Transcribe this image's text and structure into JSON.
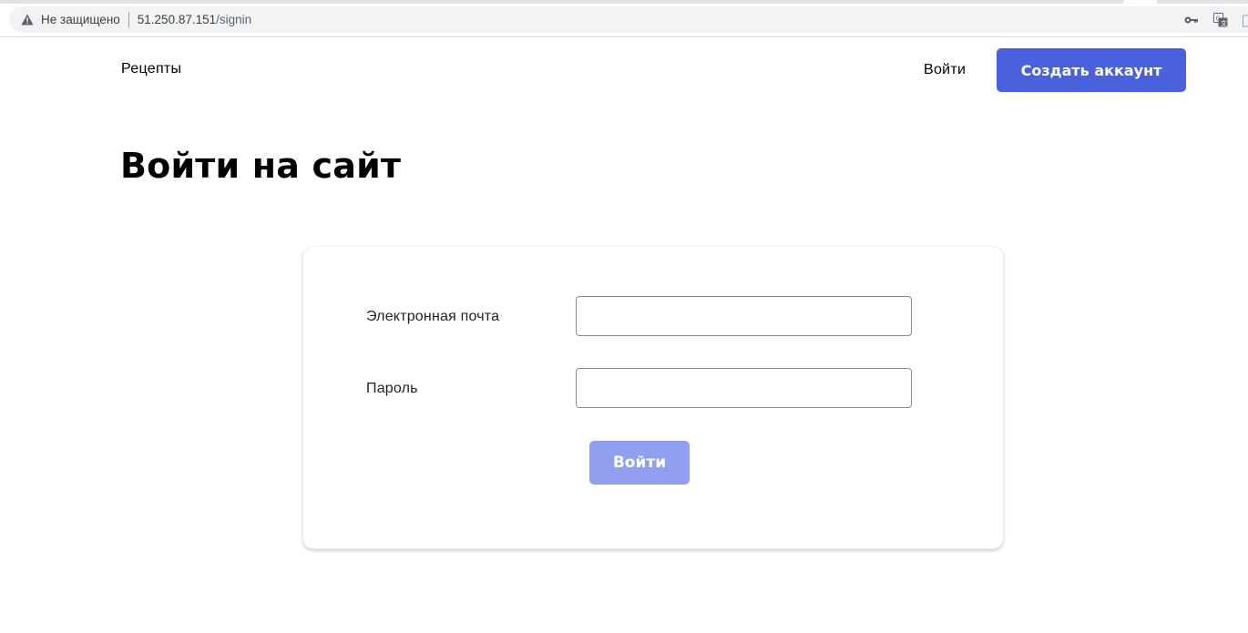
{
  "browser": {
    "security_text": "Не защищено",
    "url_host": "51.250.87.151",
    "url_path": "/signin"
  },
  "header": {
    "nav_recipes": "Рецепты",
    "nav_login": "Войти",
    "signup_button": "Создать аккаунт"
  },
  "page": {
    "title": "Войти на сайт"
  },
  "form": {
    "email_label": "Электронная почта",
    "email_value": "",
    "password_label": "Пароль",
    "password_value": "",
    "submit_label": "Войти"
  },
  "colors": {
    "primary": "#4a61dd",
    "primary_disabled": "#919ff0"
  }
}
